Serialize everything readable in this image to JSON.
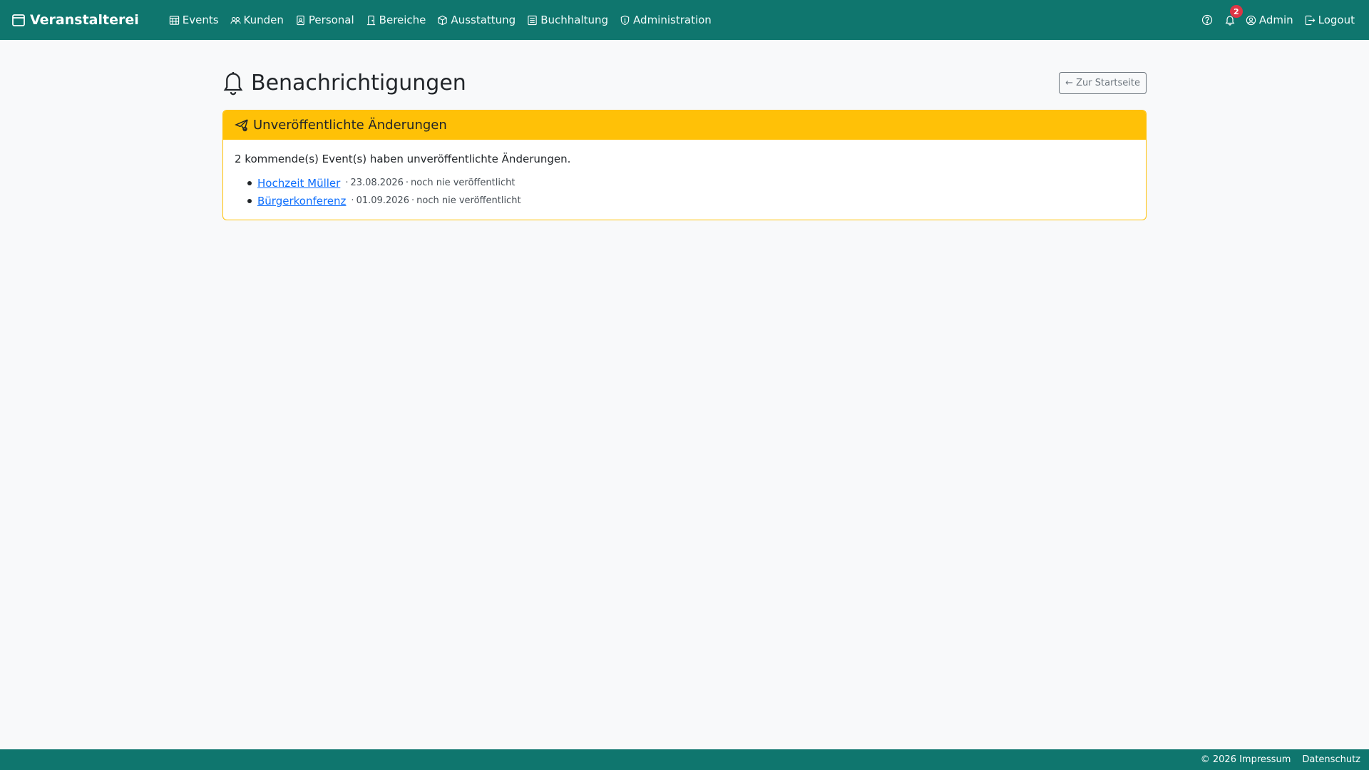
{
  "app": {
    "brand": "Veranstalterei"
  },
  "nav": {
    "items": [
      {
        "label": "Events",
        "icon": "calendar-grid-icon"
      },
      {
        "label": "Kunden",
        "icon": "people-icon"
      },
      {
        "label": "Personal",
        "icon": "person-badge-icon"
      },
      {
        "label": "Bereiche",
        "icon": "door-icon"
      },
      {
        "label": "Ausstattung",
        "icon": "box-icon"
      },
      {
        "label": "Buchhaltung",
        "icon": "ledger-icon"
      },
      {
        "label": "Administration",
        "icon": "shield-icon"
      }
    ],
    "notification_count": "2",
    "user_label": "Admin",
    "logout_label": "Logout"
  },
  "page": {
    "title": "Benachrichtigungen",
    "back_button": "← Zur Startseite"
  },
  "card": {
    "title": "Unveröffentlichte Änderungen",
    "summary": "2 kommende(s) Event(s) haben unveröffentlichte Änderungen.",
    "events": [
      {
        "name": "Hochzeit Müller",
        "date": "23.08.2026",
        "status": "noch nie veröffentlicht"
      },
      {
        "name": "Bürgerkonferenz",
        "date": "01.09.2026",
        "status": "noch nie veröffentlicht"
      }
    ],
    "separator": "·"
  },
  "footer": {
    "copyright": "© 2026 Impressum",
    "privacy": "Datenschutz"
  },
  "colors": {
    "primary": "#0f766e",
    "warning": "#ffc107",
    "link": "#0d6efd",
    "badge": "#dc3545"
  }
}
